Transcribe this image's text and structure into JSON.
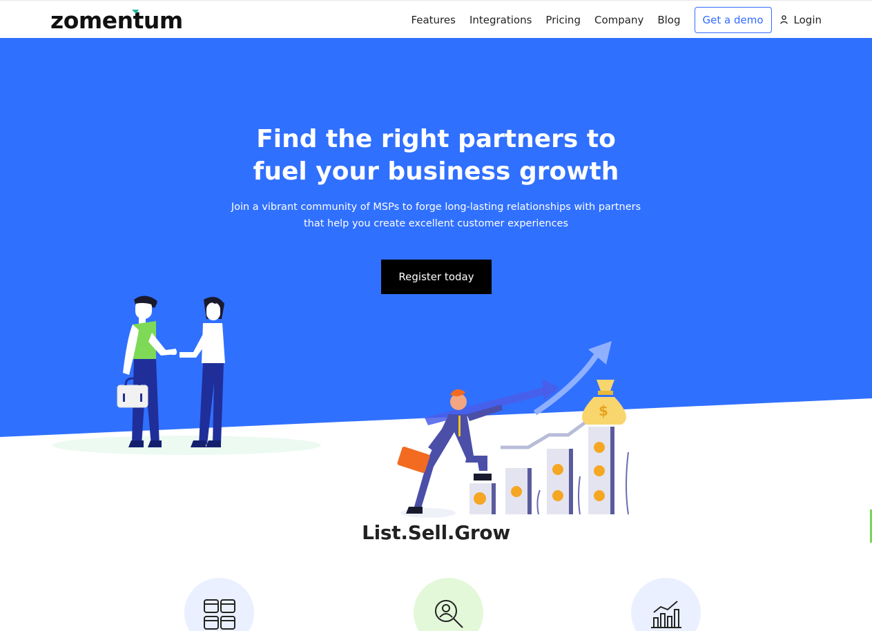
{
  "header": {
    "logo": "zomentum",
    "nav": [
      "Features",
      "Integrations",
      "Pricing",
      "Company",
      "Blog"
    ],
    "demo_label": "Get a demo",
    "login_label": "Login"
  },
  "hero": {
    "title_line1": "Find the right partners to",
    "title_line2": "fuel your business growth",
    "subtitle_line1": "Join a vibrant community of MSPs to forge long-lasting relationships with partners",
    "subtitle_line2": "that help you create excellent customer experiences",
    "cta_label": "Register today"
  },
  "tagline": "List.Sell.Grow",
  "features": [
    {
      "icon": "grid-icon"
    },
    {
      "icon": "user-search-icon"
    },
    {
      "icon": "bar-growth-icon"
    }
  ],
  "colors": {
    "brand_blue": "#3070ff",
    "accent_green": "#16b79a",
    "cta_black": "#000000"
  }
}
